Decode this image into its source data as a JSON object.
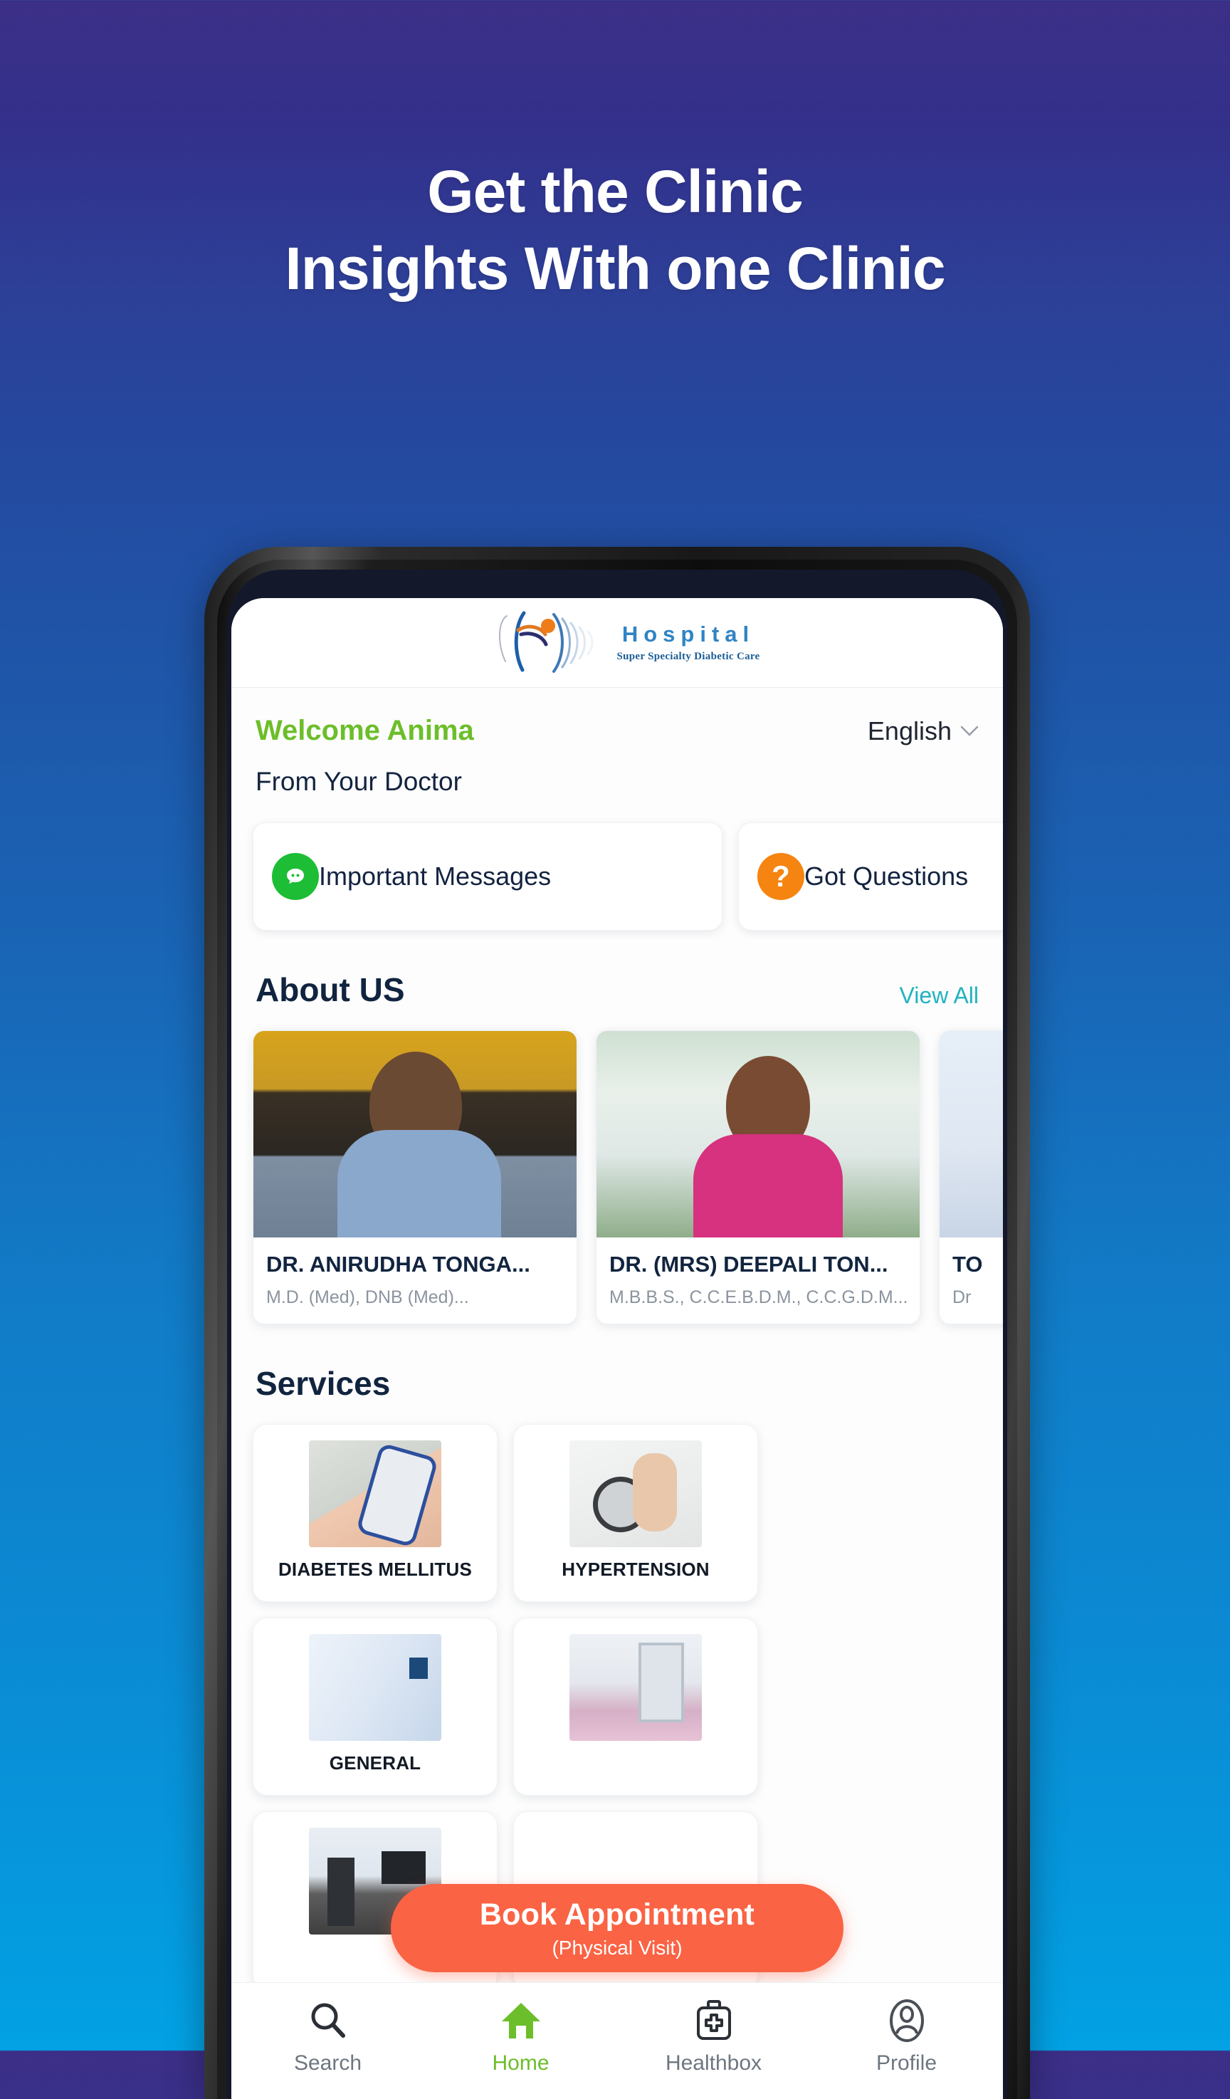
{
  "promo": {
    "headline_line1": "Get the Clinic",
    "headline_line2": "Insights With one Clinic"
  },
  "app": {
    "logo": {
      "title": "Hospital",
      "subtitle": "Super Specialty Diabetic Care",
      "mark_icon": "running-figure-waves-icon"
    },
    "welcome": {
      "greeting": "Welcome Anima",
      "language": "English",
      "language_chevron_icon": "chevron-down-icon"
    },
    "doctor_section": {
      "title": "From Your Doctor",
      "cards": [
        {
          "label": "Important Messages",
          "icon": "chat-bubble-icon",
          "color": "#1dbd35"
        },
        {
          "label": "Got Questions",
          "icon": "question-mark-icon",
          "color": "#f58410"
        }
      ]
    },
    "about": {
      "title": "About US",
      "view_all": "View All",
      "doctors": [
        {
          "name": "DR. ANIRUDHA TONGA...",
          "qualification": "M.D. (Med), DNB (Med)..."
        },
        {
          "name": "DR. (MRS) DEEPALI TON...",
          "qualification": "M.B.B.S., C.C.E.B.D.M., C.C.G.D.M...."
        },
        {
          "name": "TO",
          "qualification": "Dr"
        }
      ]
    },
    "services": {
      "title": "Services",
      "tiles": [
        {
          "label": "DIABETES MELLITUS",
          "image": "glucometer-photo"
        },
        {
          "label": "HYPERTENSION",
          "image": "blood-pressure-photo"
        },
        {
          "label": "GENERAL",
          "image": "medical-icons-photo"
        },
        {
          "label": "",
          "image": "xray-room-photo"
        },
        {
          "label": "",
          "image": "therapy-room-photo"
        },
        {
          "label": "",
          "image": ""
        }
      ]
    },
    "cta": {
      "title": "Book Appointment",
      "subtitle": "(Physical Visit)"
    },
    "bottom_nav": [
      {
        "label": "Search",
        "icon": "search-icon",
        "active": false
      },
      {
        "label": "Home",
        "icon": "home-icon",
        "active": true
      },
      {
        "label": "Healthbox",
        "icon": "medical-kit-icon",
        "active": false
      },
      {
        "label": "Profile",
        "icon": "person-icon",
        "active": false
      }
    ]
  }
}
